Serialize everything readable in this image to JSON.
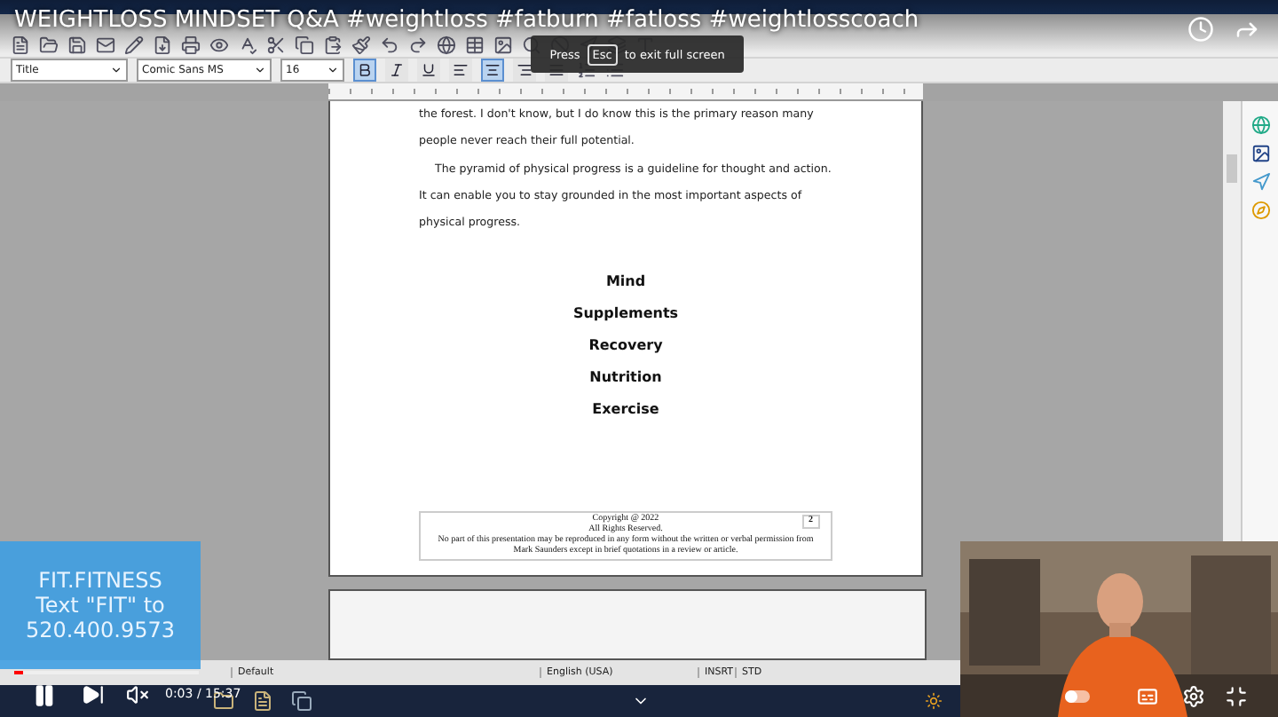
{
  "video": {
    "title": "WEIGHTLOSS MINDSET Q&A #weightloss #fatburn #fatloss #weightlosscoach",
    "time": "0:03 / 15:37",
    "playing": true,
    "muted": true,
    "level": 0.05,
    "autoplay": false
  },
  "toast": {
    "before": "Press",
    "key": "Esc",
    "after": "to exit full screen"
  },
  "promo": {
    "lines": [
      "FIT.FITNESS",
      "Text \"FIT\" to",
      "520.400.9573"
    ]
  },
  "formatting": {
    "style": "Title",
    "font": "Comic Sans MS",
    "size": "16",
    "bold": true,
    "italic": false,
    "underline": false,
    "alignments": [
      {
        "kind": "left",
        "selected": false
      },
      {
        "kind": "center",
        "selected": true
      },
      {
        "kind": "right",
        "selected": false
      },
      {
        "kind": "justify",
        "selected": false
      }
    ]
  },
  "document": {
    "paragraphs": [
      {
        "text": "the forest.  I don't know, but I do know this is the primary reason many people never reach their full potential.",
        "indent": false
      },
      {
        "text": "The pyramid of physical progress is a guideline for thought and action.  It can enable you to stay grounded in the most important aspects of physical progress.",
        "indent": true
      }
    ],
    "pyramid": [
      "Mind",
      "Supplements",
      "Recovery",
      "Nutrition",
      "Exercise"
    ],
    "footer": {
      "copyright": "Copyright @ 2022",
      "rights": "All Rights Reserved.",
      "notice": "No part of this presentation may be reproduced in any form without the written or verbal permission from Mark Saunders except in brief quotations in a review or article.",
      "page_number": "2"
    }
  },
  "status_bar": [
    "Default",
    "English (USA)",
    "INSRT",
    "STD"
  ]
}
